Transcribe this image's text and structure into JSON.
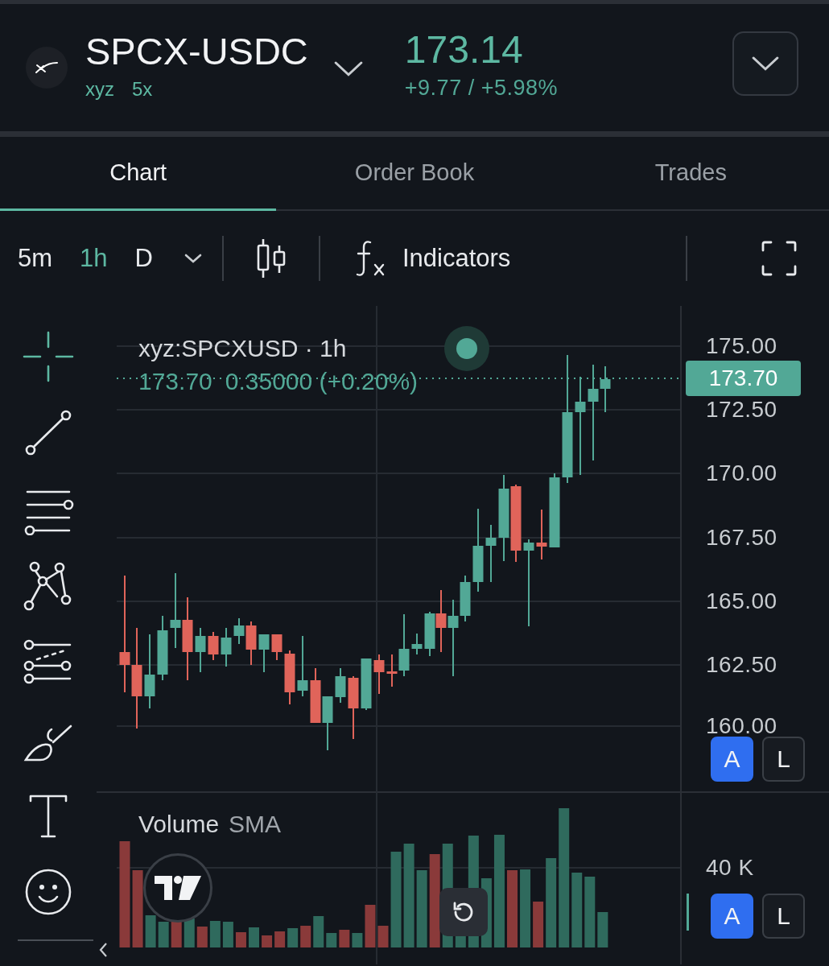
{
  "header": {
    "symbol": "SPCX-USDC",
    "tags": [
      "xyz",
      "5x"
    ],
    "price": "173.14",
    "change": "+9.77 / +5.98%"
  },
  "tabs": [
    {
      "label": "Chart",
      "selected": true
    },
    {
      "label": "Order Book",
      "selected": false
    },
    {
      "label": "Trades",
      "selected": false
    }
  ],
  "toolbar": {
    "intervals": [
      {
        "label": "5m",
        "selected": false
      },
      {
        "label": "1h",
        "selected": true
      },
      {
        "label": "D",
        "selected": false
      }
    ],
    "indicators_label": "Indicators"
  },
  "drawing_tools": [
    {
      "kind": "crosshair",
      "selected": true
    },
    {
      "kind": "trend-line",
      "selected": false
    },
    {
      "kind": "fib-lines",
      "selected": false
    },
    {
      "kind": "pattern",
      "selected": false
    },
    {
      "kind": "channel",
      "selected": false
    },
    {
      "kind": "brush",
      "selected": false
    },
    {
      "kind": "text",
      "selected": false
    },
    {
      "kind": "emoji",
      "selected": false
    }
  ],
  "price_pane": {
    "legend": {
      "symbol": "xyz:SPCXUSD · 1h",
      "last": "173.70",
      "change": "0.35000 (+0.20%)"
    },
    "price_ticks": [
      "175.00",
      "172.50",
      "170.00",
      "167.50",
      "165.00",
      "162.50",
      "160.00"
    ],
    "current_price": "173.70",
    "scale_modes": [
      {
        "label": "A",
        "selected": true
      },
      {
        "label": "L",
        "selected": false
      }
    ]
  },
  "volume_pane": {
    "legend": {
      "title": "Volume",
      "study": "SMA"
    },
    "tick": "40 K",
    "scale_modes": [
      {
        "label": "A",
        "selected": true
      },
      {
        "label": "L",
        "selected": false
      }
    ]
  }
}
